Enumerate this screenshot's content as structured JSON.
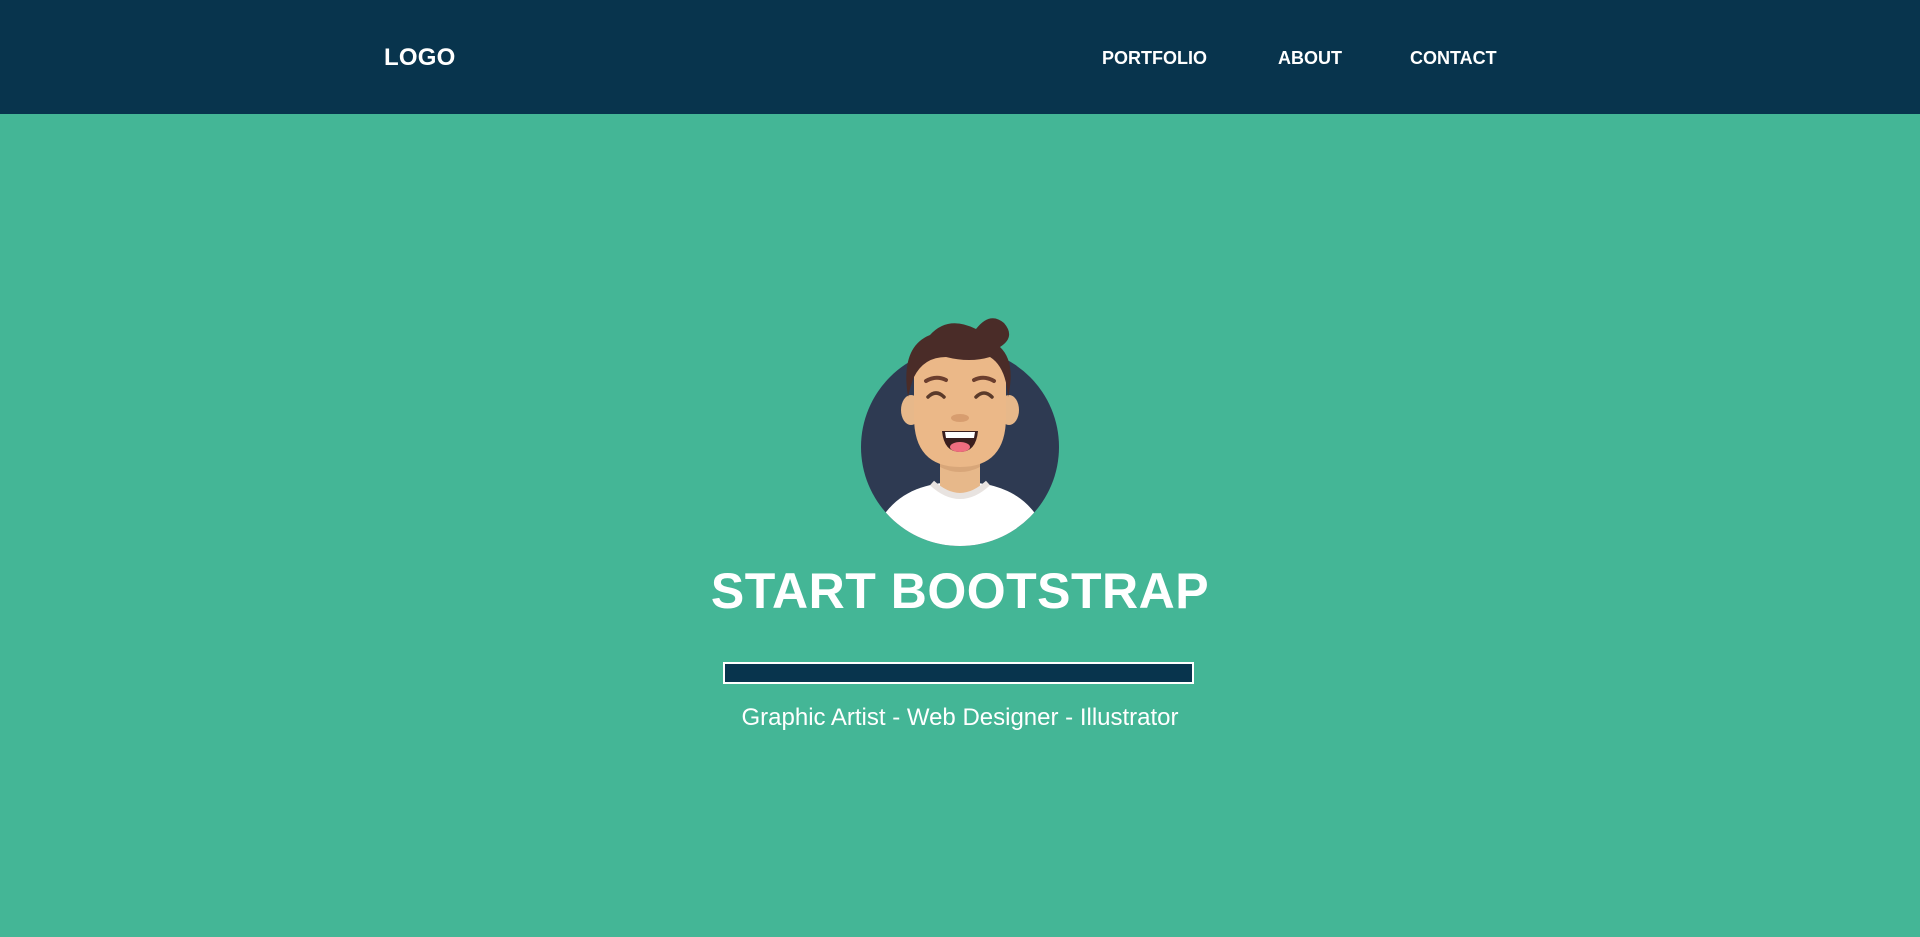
{
  "navbar": {
    "logo": "LOGO",
    "links": [
      {
        "label": "PORTFOLIO"
      },
      {
        "label": "ABOUT"
      },
      {
        "label": "CONTACT"
      }
    ],
    "background_color": "#08344d"
  },
  "hero": {
    "background_color": "#44b696",
    "avatar_icon": "smiling-person-avatar-icon",
    "title": "START BOOTSTRAP",
    "subtitle": "Graphic Artist - Web Designer - Illustrator"
  }
}
